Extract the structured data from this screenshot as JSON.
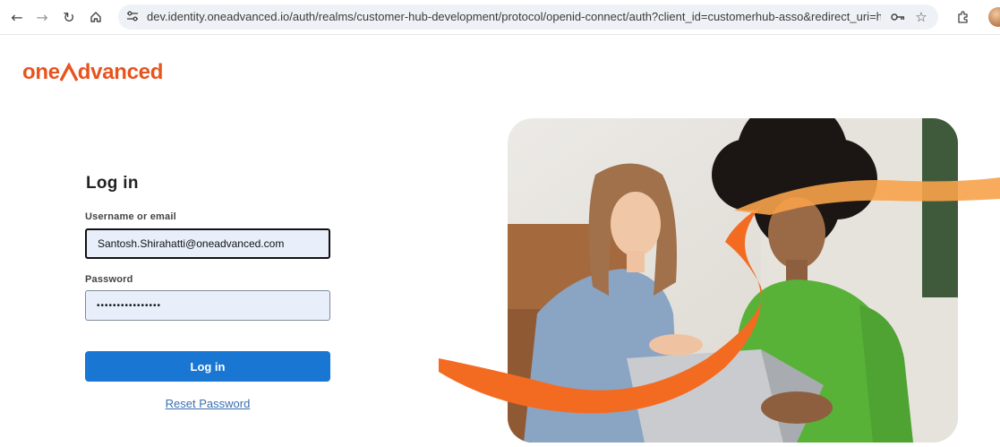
{
  "browser": {
    "url": "dev.identity.oneadvanced.io/auth/realms/customer-hub-development/protocol/openid-connect/auth?client_id=customerhub-asso&redirect_uri=https%3..."
  },
  "brand": {
    "logo_text_left": "one",
    "logo_text_right": "dvanced",
    "accent": "#e8541e"
  },
  "login": {
    "title": "Log in",
    "username_label": "Username or email",
    "username_value": "Santosh.Shirahatti@oneadvanced.com",
    "password_label": "Password",
    "password_value": "••••••••••••••••",
    "submit_label": "Log in",
    "reset_label": "Reset Password",
    "button_color": "#1976d2"
  },
  "icons": {
    "back": "arrow-left-icon",
    "forward": "arrow-right-icon",
    "reload": "reload-icon",
    "home": "home-icon",
    "site_settings": "tune-icon",
    "password_key": "key-icon",
    "bookmark": "star-icon",
    "extensions": "puzzle-icon"
  }
}
